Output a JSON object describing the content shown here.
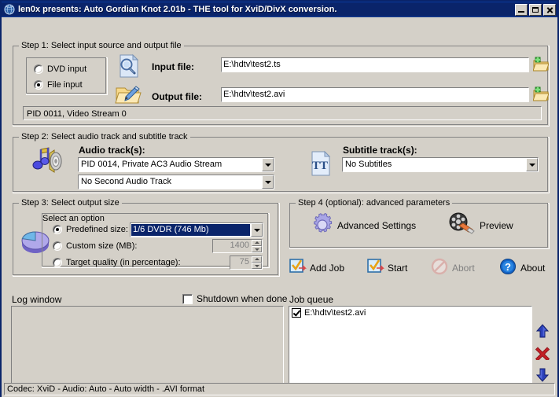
{
  "window": {
    "title": "len0x presents: Auto Gordian Knot 2.01b - THE tool for XviD/DivX conversion.",
    "app_icon": "globe-icon",
    "minimize_label": "Minimize",
    "maximize_label": "Maximize",
    "close_label": "Close",
    "titlebar_color": "#0a246a",
    "face_color": "#d4d0c8"
  },
  "step1": {
    "legend": "Step 1: Select input source and output file",
    "dvd_input_label": "DVD input",
    "file_input_label": "File input",
    "dvd_input_checked": false,
    "file_input_checked": true,
    "input_file_label": "Input file:",
    "input_file_value": "E:\\hdtv\\test2.ts",
    "output_file_label": "Output file:",
    "output_file_value": "E:\\hdtv\\test2.avi",
    "input_icon": "file-search-icon",
    "output_icon": "folder-edit-icon",
    "browse_input_icon": "open-folder-icon",
    "browse_output_icon": "open-folder-icon",
    "stream_info": "PID 0011, Video Stream 0"
  },
  "step2": {
    "legend": "Step 2: Select audio track and subtitle track",
    "audio_icon": "speaker-note-icon",
    "audio_label": "Audio track(s):",
    "audio_track_1": "PID 0014, Private AC3 Audio Stream",
    "audio_track_2": "No Second Audio Track",
    "subtitle_icon": "subtitle-tt-icon",
    "subtitle_label": "Subtitle track(s):",
    "subtitle_track": "No Subtitles"
  },
  "step3": {
    "legend": "Step 3: Select output size",
    "pie_icon": "pie-chart-icon",
    "option_legend": "Select an option",
    "predefined_label": "Predefined size:",
    "predefined_checked": true,
    "predefined_value": "1/6 DVDR (746 Mb)",
    "custom_label": "Custom size (MB):",
    "custom_checked": false,
    "custom_value": "1400",
    "quality_label": "Target quality (in percentage):",
    "quality_checked": false,
    "quality_value": "75"
  },
  "step4": {
    "legend": "Step 4 (optional): advanced parameters",
    "advanced_icon": "gear-icon",
    "advanced_label": "Advanced Settings",
    "preview_icon": "film-reel-icon",
    "preview_label": "Preview"
  },
  "actions": {
    "add_job_icon": "checklist-arrow-icon",
    "add_job_label": "Add Job",
    "start_icon": "checklist-arrow-icon",
    "start_label": "Start",
    "abort_icon": "no-entry-icon",
    "abort_label": "Abort",
    "abort_disabled": true,
    "about_icon": "question-mark-icon",
    "about_label": "About"
  },
  "log": {
    "label": "Log window",
    "content": "",
    "shutdown_label": "Shutdown when done",
    "shutdown_checked": false
  },
  "queue": {
    "label": "Job queue",
    "items": [
      {
        "checked": true,
        "label": "E:\\hdtv\\test2.avi"
      }
    ],
    "move_up_icon": "arrow-up-icon",
    "remove_icon": "red-x-icon",
    "move_down_icon": "arrow-down-icon"
  },
  "statusbar": {
    "text": "Codec: XviD -  Audio: Auto -  Auto width - .AVI format"
  }
}
